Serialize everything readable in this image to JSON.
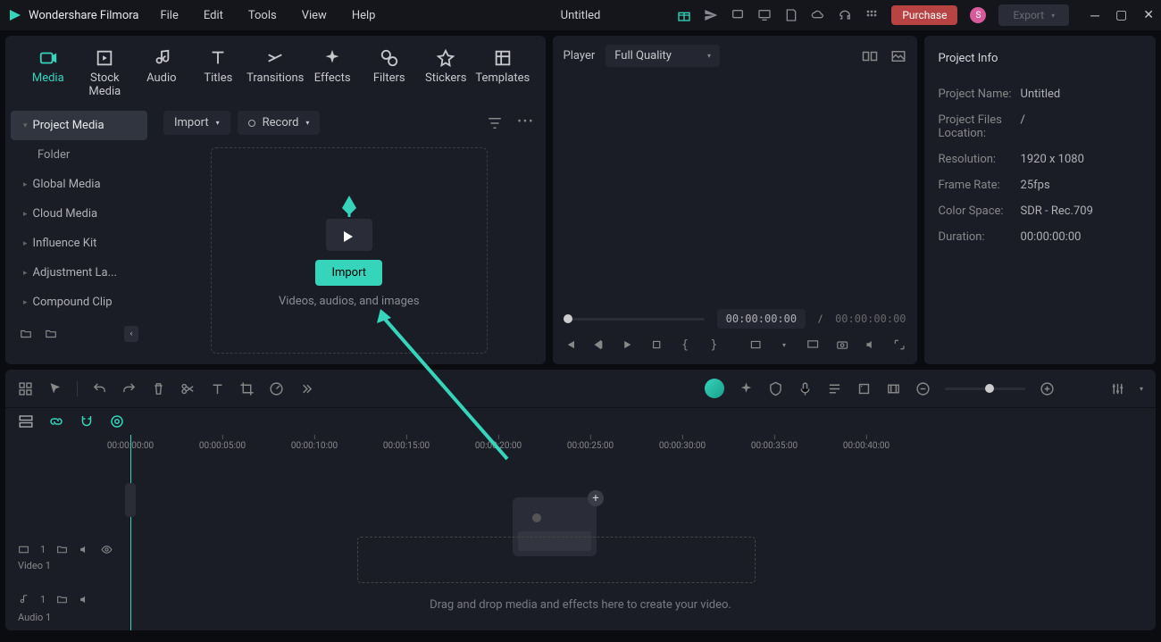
{
  "app": {
    "name": "Wondershare Filmora",
    "doc_title": "Untitled"
  },
  "menu": [
    "File",
    "Edit",
    "Tools",
    "View",
    "Help"
  ],
  "titlebar": {
    "purchase": "Purchase",
    "export": "Export",
    "avatar_initial": "S"
  },
  "media_tabs": [
    {
      "label": "Media",
      "active": true
    },
    {
      "label": "Stock Media"
    },
    {
      "label": "Audio"
    },
    {
      "label": "Titles"
    },
    {
      "label": "Transitions"
    },
    {
      "label": "Effects"
    },
    {
      "label": "Filters"
    },
    {
      "label": "Stickers"
    },
    {
      "label": "Templates"
    }
  ],
  "sidebar": {
    "items": [
      {
        "label": "Project Media",
        "sel": true
      },
      {
        "label": "Folder",
        "folder": true
      },
      {
        "label": "Global Media"
      },
      {
        "label": "Cloud Media"
      },
      {
        "label": "Influence Kit"
      },
      {
        "label": "Adjustment La..."
      },
      {
        "label": "Compound Clip"
      }
    ]
  },
  "content_bar": {
    "import": "Import",
    "record": "Record"
  },
  "dropzone": {
    "button": "Import",
    "hint": "Videos, audios, and images"
  },
  "player": {
    "title": "Player",
    "quality": "Full Quality",
    "time_current": "00:00:00:00",
    "time_sep": "/",
    "time_total": "00:00:00:00"
  },
  "project_info": {
    "title": "Project Info",
    "rows": [
      {
        "label": "Project Name:",
        "value": "Untitled"
      },
      {
        "label": "Project Files Location:",
        "value": "/"
      },
      {
        "label": "Resolution:",
        "value": "1920 x 1080"
      },
      {
        "label": "Frame Rate:",
        "value": "25fps"
      },
      {
        "label": "Color Space:",
        "value": "SDR - Rec.709"
      },
      {
        "label": "Duration:",
        "value": "00:00:00:00"
      }
    ]
  },
  "ruler_ticks": [
    "00:00:00:00",
    "00:00:05:00",
    "00:00:10:00",
    "00:00:15:00",
    "00:00:20:00",
    "00:00:25:00",
    "00:00:30:00",
    "00:00:35:00",
    "00:00:40:00"
  ],
  "timeline": {
    "hint": "Drag and drop media and effects here to create your video.",
    "track_video": "Video 1",
    "track_audio": "Audio 1",
    "track_num": "1"
  }
}
